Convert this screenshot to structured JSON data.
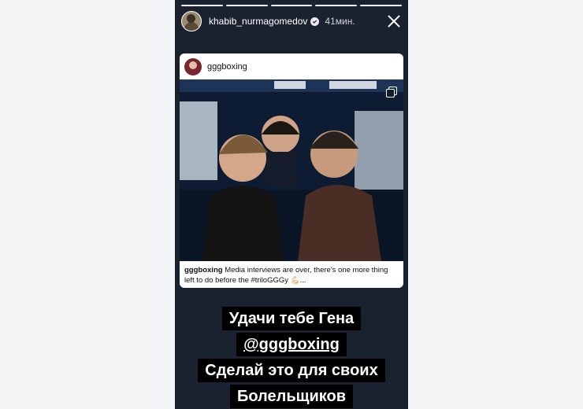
{
  "story": {
    "username": "khabib_nurmagomedov",
    "time": "41мин.",
    "progress_segments": 5
  },
  "shared_post": {
    "username": "gggboxing",
    "caption_user": "gggboxing",
    "caption_text": "Media interviews are over, there's one more thing left to do before the #trilоGGGy 💪🏻..."
  },
  "overlay_text": {
    "line1": "Удачи тебе Гена",
    "line2": "@gggboxing",
    "line3": "Сделай это для своих",
    "line4": "Болельщиков"
  },
  "icons": {
    "verified": "verified-badge-icon",
    "close": "close-icon",
    "multi_photo": "carousel-icon"
  }
}
